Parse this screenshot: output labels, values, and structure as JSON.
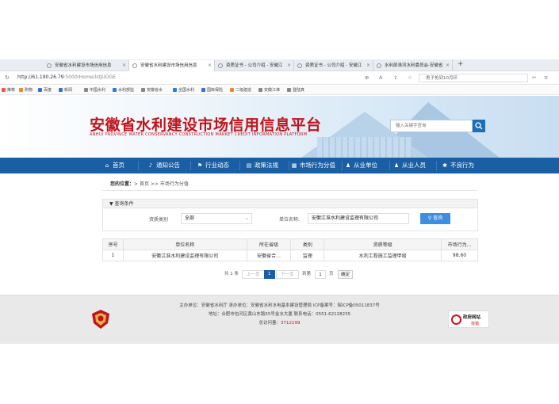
{
  "browser": {
    "tabs": [
      {
        "label": "安徽省水利建设市场信用信息"
      },
      {
        "label": "安徽省水利建设市场信用信息"
      },
      {
        "label": "资质证书 - 公司介绍 - 安徽江"
      },
      {
        "label": "资质证书 - 公司介绍 - 安徽江"
      },
      {
        "label": "水利部淮河水利委员会-安徽省"
      }
    ],
    "new_tab": "+",
    "url_host": "http://61.190.26.79",
    "url_path": ":5000/Home/lstJUDGE",
    "search_text": "男子抢到10月环",
    "bookmarks": [
      {
        "label": "推荐",
        "color": "#e55"
      },
      {
        "label": "购物",
        "color": "#e88a2b"
      },
      {
        "label": "百度",
        "color": "#3a6fd8"
      },
      {
        "label": "新闻",
        "color": "#3a6fd8"
      },
      {
        "label": "中国水利",
        "color": "#888"
      },
      {
        "label": "水利部监",
        "color": "#2b7bd8"
      },
      {
        "label": "安徽省水",
        "color": "#888"
      },
      {
        "label": "全国水利",
        "color": "#2b7bd8"
      },
      {
        "label": "国库保险",
        "color": "#3a6fd8"
      },
      {
        "label": "二级建造",
        "color": "#e88a2b"
      },
      {
        "label": "安徽江准",
        "color": "#888"
      },
      {
        "label": "登陆真",
        "color": "#888"
      }
    ]
  },
  "site": {
    "title": "安徽省水利建设市场信用信息平台",
    "subtitle": "ANHUI PROVINCE WATER CONSERVANCY CONSTRUCTION MARKET CREDIT INFORMATION PLATFORM",
    "search_placeholder": "输入关键字查询",
    "nav": [
      {
        "label": "首页",
        "icon": "home-icon"
      },
      {
        "label": "通知公告",
        "icon": "bell-icon"
      },
      {
        "label": "行业动态",
        "icon": "flag-icon"
      },
      {
        "label": "政策法规",
        "icon": "book-icon"
      },
      {
        "label": "市场行为分值",
        "icon": "chart-icon"
      },
      {
        "label": "从业单位",
        "icon": "user-icon"
      },
      {
        "label": "从业人员",
        "icon": "users-icon"
      },
      {
        "label": "不良行为",
        "icon": "cog-icon"
      }
    ]
  },
  "breadcrumb": {
    "label": "您的位置：",
    "path": "> 首页 >> 市场行为分值"
  },
  "query": {
    "title": "查询条件",
    "type_label": "资质类别",
    "type_value": "全部",
    "name_label": "单位名称:",
    "name_value": "安徽江准水利建设监理有限公司",
    "button": "查询"
  },
  "table": {
    "headers": [
      "序号",
      "单位名称",
      "所在省级",
      "类别",
      "资质等级",
      "市场行为..."
    ],
    "rows": [
      [
        "1",
        "安徽江准水利建设监理有限公司",
        "安徽省合...",
        "监理",
        "水利工程施工监理甲级",
        "98.60"
      ]
    ]
  },
  "pager": {
    "total": "共 1 条",
    "prev": "上一页",
    "current": "1",
    "next": "下一页",
    "jump": "到第",
    "page_input": "1",
    "page_unit": "页",
    "go": "确定"
  },
  "footer": {
    "line1": "主办单位：安徽省水利厅  承办单位：安徽省水利水电基本建设管理局  ICP备案号：皖ICP备05011837号",
    "line2": "地址：合肥市包河区黄山东路55号金水大厦  联系电话：0551-62128235",
    "visits_label": "总访问量：",
    "visits_value": "3712199",
    "gov_badge_1": "政府网站",
    "gov_badge_2": "找错"
  }
}
